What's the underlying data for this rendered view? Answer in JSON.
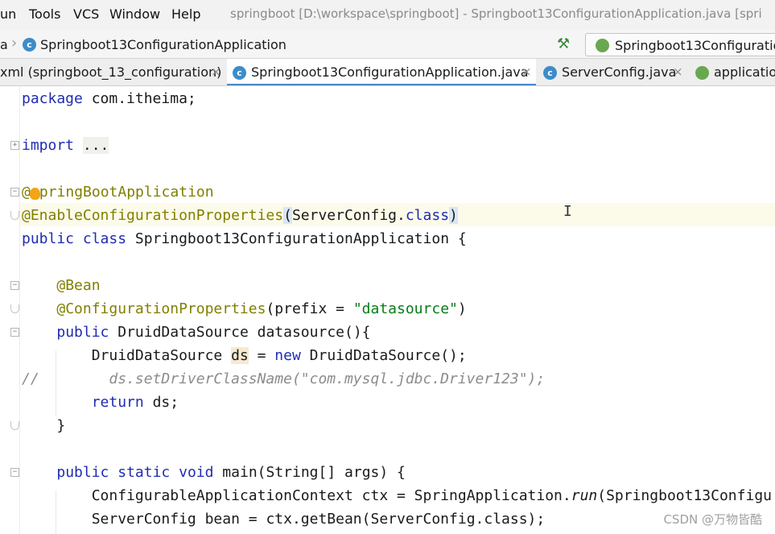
{
  "menubar": {
    "items": [
      "un",
      "Tools",
      "VCS",
      "Window",
      "Help"
    ],
    "title": "springboot [D:\\workspace\\springboot] - Springboot13ConfigurationApplication.java [spri"
  },
  "navbar": {
    "crumb_first": "a",
    "crumb_class": "Springboot13ConfigurationApplication",
    "run_config": "Springboot13Configuratio",
    "icons": {
      "class": "class-icon",
      "build": "hammer-icon",
      "run": "spring-icon"
    }
  },
  "tabs": [
    {
      "label": "xml (springboot_13_configuration)",
      "close": "×",
      "active": false
    },
    {
      "label": "Springboot13ConfigurationApplication.java",
      "close": "×",
      "active": true
    },
    {
      "label": "ServerConfig.java",
      "close": "×",
      "active": false
    },
    {
      "label": "applicatio",
      "close": "",
      "active": false
    }
  ],
  "code": {
    "l1_kw": "package",
    "l1_rest": " com.itheima;",
    "l3_kw": "import",
    "l3_dots": "...",
    "l5_at": "@",
    "l5_rest": "pringBootApplication",
    "l6_ann": "@EnableConfigurationProperties",
    "l6_open": "(",
    "l6_cls": "ServerConfig.",
    "l6_kw": "class",
    "l6_close": ")",
    "l7_kw1": "public",
    "l7_kw2": "class",
    "l7_rest": " Springboot13ConfigurationApplication {",
    "l9_ann": "@Bean",
    "l10_ann": "@ConfigurationProperties",
    "l10_a": "(prefix = ",
    "l10_str": "\"datasource\"",
    "l10_b": ")",
    "l11_kw": "public",
    "l11_rest": " DruidDataSource datasource(){",
    "l12_type": "DruidDataSource ",
    "l12_var": "ds",
    "l12_eq": " = ",
    "l12_kw": "new",
    "l12_rest": " DruidDataSource();",
    "l13_cmt": "//        ds.setDriverClassName(\"com.mysql.jdbc.Driver123\");",
    "l14_kw": "return",
    "l14_rest": " ds;",
    "l15_brace": "}",
    "l17_kw1": "public",
    "l17_kw2": "static",
    "l17_kw3": "void",
    "l17_rest": " main(String[] args) {",
    "l18_a": "ConfigurableApplicationContext ctx = SpringApplication.",
    "l18_run": "run",
    "l18_b": "(Springboot13Configu",
    "l19_partial": "ServerConfig bean = ctx.getBean(ServerConfig.class);"
  },
  "watermark": "CSDN @万物皆酷"
}
